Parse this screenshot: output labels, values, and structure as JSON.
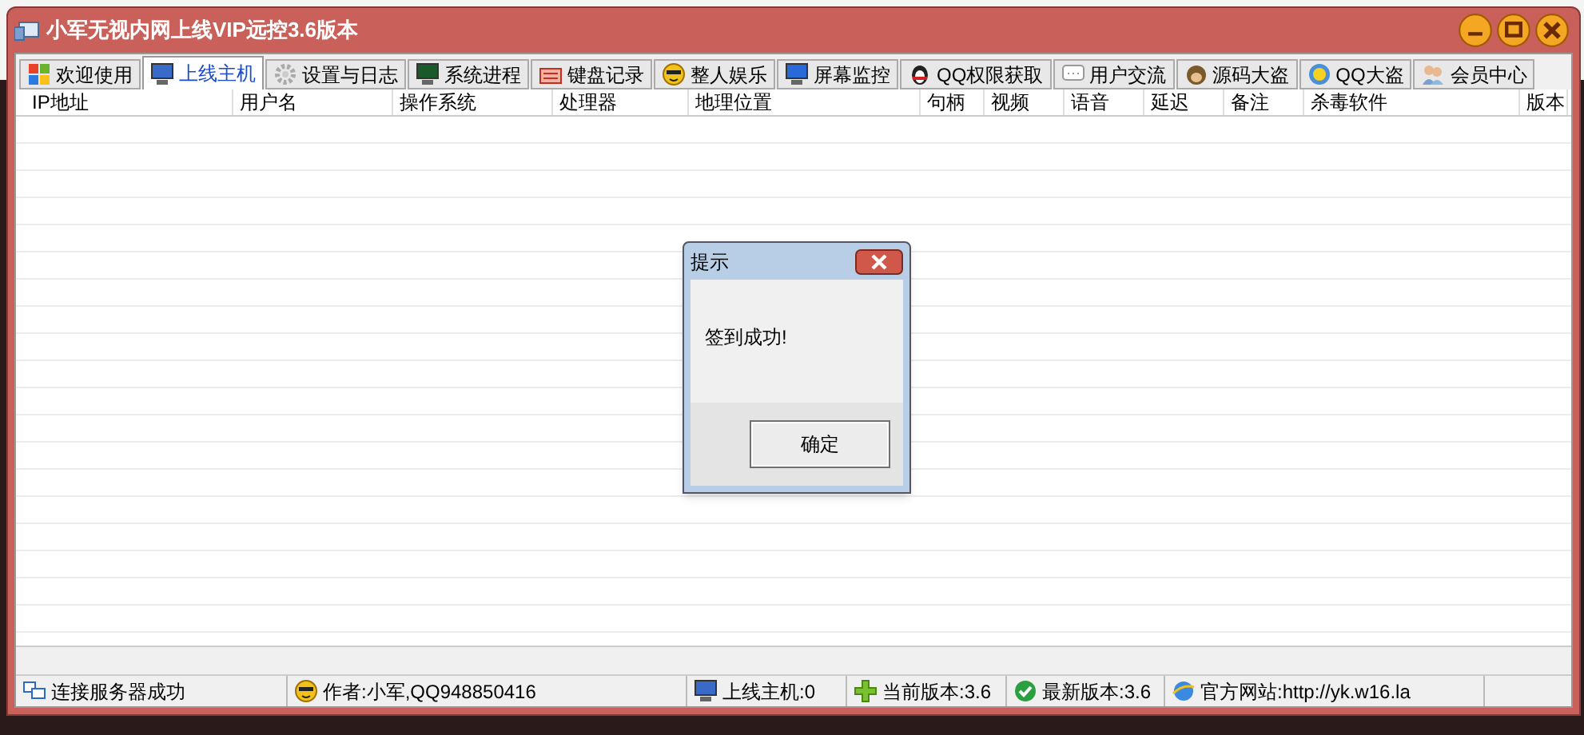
{
  "window": {
    "title": "小军无视内网上线VIP远控3.6版本"
  },
  "tabs": [
    {
      "label": "欢迎使用",
      "selected": false
    },
    {
      "label": "上线主机",
      "selected": true
    },
    {
      "label": "设置与日志",
      "selected": false
    },
    {
      "label": "系统进程",
      "selected": false
    },
    {
      "label": "键盘记录",
      "selected": false
    },
    {
      "label": "整人娱乐",
      "selected": false
    },
    {
      "label": "屏幕监控",
      "selected": false
    },
    {
      "label": "QQ权限获取",
      "selected": false
    },
    {
      "label": "用户交流",
      "selected": false
    },
    {
      "label": "源码大盗",
      "selected": false
    },
    {
      "label": "QQ大盗",
      "selected": false
    },
    {
      "label": "会员中心",
      "selected": false
    }
  ],
  "table": {
    "columns": [
      "IP地址",
      "用户名",
      "操作系统",
      "处理器",
      "地理位置",
      "句柄",
      "视频",
      "语音",
      "延迟",
      "备注",
      "杀毒软件",
      "版本"
    ]
  },
  "dialog": {
    "title": "提示",
    "message": "签到成功!",
    "button": "确定"
  },
  "status_bar": [
    "连接服务器成功",
    "作者:小军,QQ948850416",
    "上线主机:0",
    "当前版本:3.6",
    "最新版本:3.6",
    "官方网站:http://yk.w16.la"
  ]
}
